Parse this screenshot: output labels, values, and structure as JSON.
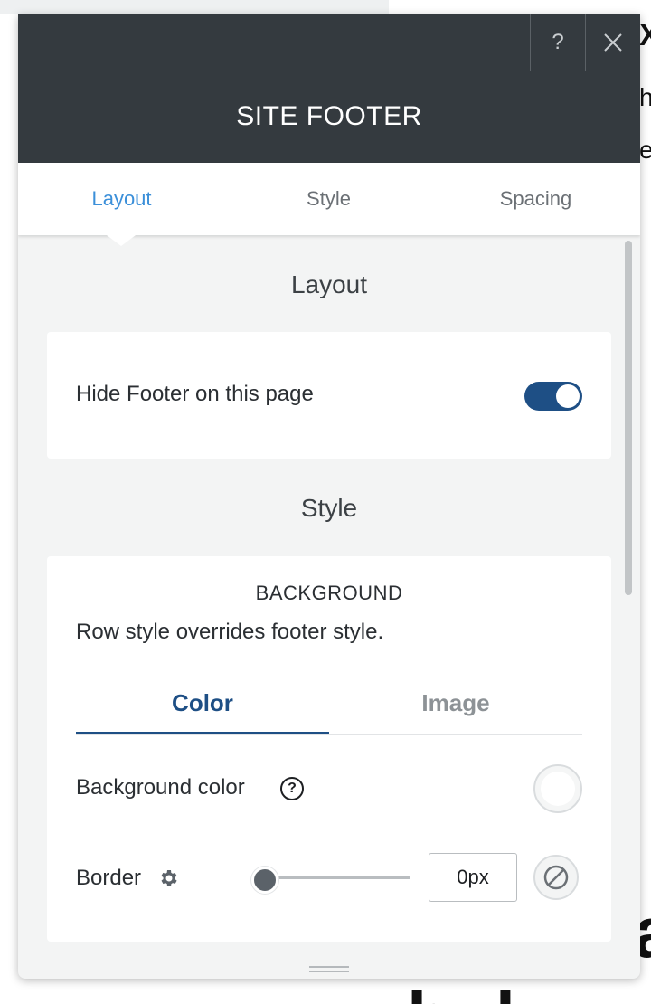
{
  "background_page": {
    "fragments": [
      "X",
      "he",
      "et",
      "a",
      "b d"
    ]
  },
  "panel": {
    "help_button": "?",
    "close_button": "✕",
    "title": "SITE FOOTER",
    "tabs": [
      {
        "label": "Layout",
        "active": true
      },
      {
        "label": "Style",
        "active": false
      },
      {
        "label": "Spacing",
        "active": false
      }
    ]
  },
  "layout_section": {
    "heading": "Layout",
    "hide_footer_label": "Hide Footer on this page",
    "hide_footer_on": true
  },
  "style_section": {
    "heading": "Style",
    "background": {
      "title": "BACKGROUND",
      "note": "Row style overrides footer style.",
      "subtabs": [
        {
          "label": "Color",
          "active": true
        },
        {
          "label": "Image",
          "active": false
        }
      ],
      "bg_color_label": "Background color",
      "bg_color_help": "?",
      "bg_color_value": "#ffffff",
      "border_label": "Border",
      "border_value": "0px",
      "border_slider_value": 0
    }
  },
  "colors": {
    "header_bg": "#343a3f",
    "active_tab": "#3b8fd9",
    "toggle_on": "#1e4f85",
    "subtab_active": "#1e4f85"
  }
}
